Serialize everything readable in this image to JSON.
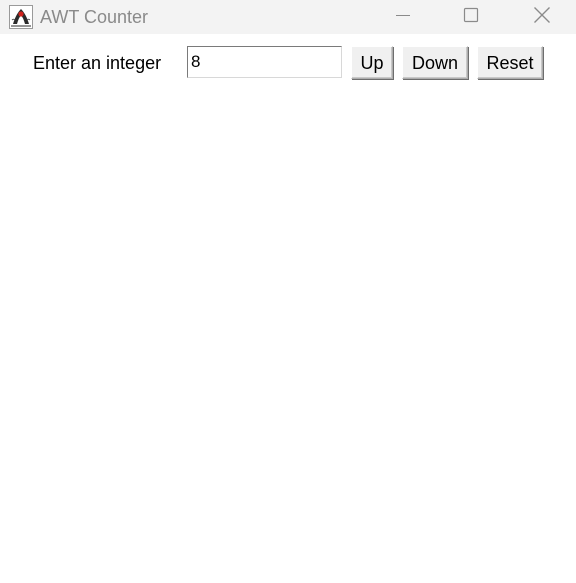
{
  "window": {
    "title": "AWT Counter",
    "app_icon": "java-duke-icon"
  },
  "titlebar_controls": {
    "minimize_icon": "minimize-icon",
    "maximize_icon": "maximize-icon",
    "close_icon": "close-icon"
  },
  "counter": {
    "label": "Enter an integer",
    "value": "8"
  },
  "buttons": {
    "up_label": "Up",
    "down_label": "Down",
    "reset_label": "Reset"
  },
  "colors": {
    "titlebar_bg": "#f3f3f3",
    "title_text": "#8a8a8a",
    "content_bg": "#ffffff",
    "button_bg": "#f0f0f0"
  }
}
